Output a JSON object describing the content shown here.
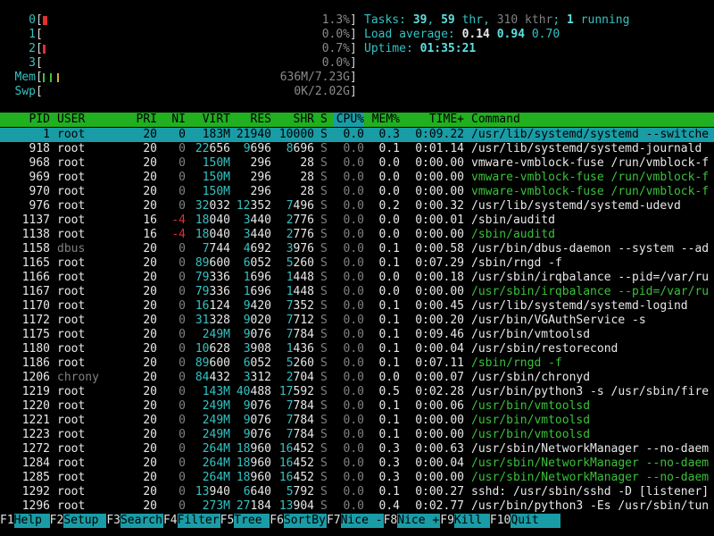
{
  "meters": {
    "cpu": [
      {
        "label": "0",
        "value": "1.3%",
        "fill": 0.02
      },
      {
        "label": "1",
        "value": "0.0%",
        "fill": 0.0
      },
      {
        "label": "2",
        "value": "0.7%",
        "fill": 0.01
      },
      {
        "label": "3",
        "value": "0.0%",
        "fill": 0.0
      }
    ],
    "mem": {
      "label": "Mem",
      "value": "636M/7.23G",
      "fill": 0.086
    },
    "swp": {
      "label": "Swp",
      "value": "0K/2.02G",
      "fill": 0.0
    }
  },
  "summary": {
    "tasks_label": "Tasks: ",
    "tasks": "39",
    "sep1": ", ",
    "thr": "59",
    "thr_label": " thr, ",
    "kthr": "310 kthr",
    "sep2": "; ",
    "running": "1",
    "running_label": " running",
    "load_label": "Load average: ",
    "load1": "0.14",
    "load5": "0.94",
    "load15": "0.70",
    "uptime_label": "Uptime: ",
    "uptime": "01:35:21"
  },
  "columns": {
    "pid": "PID",
    "user": "USER",
    "pri": "PRI",
    "ni": "NI",
    "virt": "VIRT",
    "res": "RES",
    "shr": "SHR",
    "s": "S",
    "cpu": "CPU%",
    "mem": "MEM%",
    "time": "TIME+",
    "command": "Command"
  },
  "processes": [
    {
      "pid": "1",
      "user": "root",
      "pri": "20",
      "ni": "0",
      "virt": "183M",
      "res": "21940",
      "shr": "10000",
      "s": "S",
      "cpu": "0.0",
      "mem": "0.3",
      "time": "0:09.22",
      "command": "/usr/lib/systemd/systemd --switche",
      "selected": true
    },
    {
      "pid": "918",
      "user": "root",
      "pri": "20",
      "ni": "0",
      "virt": "22656",
      "res": "9696",
      "shr": "8696",
      "s": "S",
      "cpu": "0.0",
      "mem": "0.1",
      "time": "0:01.14",
      "command": "/usr/lib/systemd/systemd-journald"
    },
    {
      "pid": "968",
      "user": "root",
      "pri": "20",
      "ni": "0",
      "virt": "150M",
      "res": "296",
      "shr": "28",
      "s": "S",
      "cpu": "0.0",
      "mem": "0.0",
      "time": "0:00.00",
      "command": "vmware-vmblock-fuse /run/vmblock-f"
    },
    {
      "pid": "969",
      "user": "root",
      "pri": "20",
      "ni": "0",
      "virt": "150M",
      "res": "296",
      "shr": "28",
      "s": "S",
      "cpu": "0.0",
      "mem": "0.0",
      "time": "0:00.00",
      "command": "vmware-vmblock-fuse /run/vmblock-f",
      "thread": true
    },
    {
      "pid": "970",
      "user": "root",
      "pri": "20",
      "ni": "0",
      "virt": "150M",
      "res": "296",
      "shr": "28",
      "s": "S",
      "cpu": "0.0",
      "mem": "0.0",
      "time": "0:00.00",
      "command": "vmware-vmblock-fuse /run/vmblock-f",
      "thread": true
    },
    {
      "pid": "976",
      "user": "root",
      "pri": "20",
      "ni": "0",
      "virt": "32032",
      "res": "12352",
      "shr": "7496",
      "s": "S",
      "cpu": "0.0",
      "mem": "0.2",
      "time": "0:00.32",
      "command": "/usr/lib/systemd/systemd-udevd"
    },
    {
      "pid": "1137",
      "user": "root",
      "pri": "16",
      "ni": "-4",
      "virt": "18040",
      "res": "3440",
      "shr": "2776",
      "s": "S",
      "cpu": "0.0",
      "mem": "0.0",
      "time": "0:00.01",
      "command": "/sbin/auditd"
    },
    {
      "pid": "1138",
      "user": "root",
      "pri": "16",
      "ni": "-4",
      "virt": "18040",
      "res": "3440",
      "shr": "2776",
      "s": "S",
      "cpu": "0.0",
      "mem": "0.0",
      "time": "0:00.00",
      "command": "/sbin/auditd",
      "thread": true
    },
    {
      "pid": "1158",
      "user": "dbus",
      "pri": "20",
      "ni": "0",
      "virt": "7744",
      "res": "4692",
      "shr": "3976",
      "s": "S",
      "cpu": "0.0",
      "mem": "0.1",
      "time": "0:00.58",
      "command": "/usr/bin/dbus-daemon --system --ad",
      "grayuser": true
    },
    {
      "pid": "1165",
      "user": "root",
      "pri": "20",
      "ni": "0",
      "virt": "89600",
      "res": "6052",
      "shr": "5260",
      "s": "S",
      "cpu": "0.0",
      "mem": "0.1",
      "time": "0:07.29",
      "command": "/sbin/rngd -f"
    },
    {
      "pid": "1166",
      "user": "root",
      "pri": "20",
      "ni": "0",
      "virt": "79336",
      "res": "1696",
      "shr": "1448",
      "s": "S",
      "cpu": "0.0",
      "mem": "0.0",
      "time": "0:00.18",
      "command": "/usr/sbin/irqbalance --pid=/var/ru"
    },
    {
      "pid": "1167",
      "user": "root",
      "pri": "20",
      "ni": "0",
      "virt": "79336",
      "res": "1696",
      "shr": "1448",
      "s": "S",
      "cpu": "0.0",
      "mem": "0.0",
      "time": "0:00.00",
      "command": "/usr/sbin/irqbalance --pid=/var/ru",
      "thread": true
    },
    {
      "pid": "1170",
      "user": "root",
      "pri": "20",
      "ni": "0",
      "virt": "16124",
      "res": "9420",
      "shr": "7352",
      "s": "S",
      "cpu": "0.0",
      "mem": "0.1",
      "time": "0:00.45",
      "command": "/usr/lib/systemd/systemd-logind"
    },
    {
      "pid": "1172",
      "user": "root",
      "pri": "20",
      "ni": "0",
      "virt": "31328",
      "res": "9020",
      "shr": "7712",
      "s": "S",
      "cpu": "0.0",
      "mem": "0.1",
      "time": "0:00.20",
      "command": "/usr/bin/VGAuthService -s"
    },
    {
      "pid": "1175",
      "user": "root",
      "pri": "20",
      "ni": "0",
      "virt": "249M",
      "res": "9076",
      "shr": "7784",
      "s": "S",
      "cpu": "0.0",
      "mem": "0.1",
      "time": "0:09.46",
      "command": "/usr/bin/vmtoolsd"
    },
    {
      "pid": "1180",
      "user": "root",
      "pri": "20",
      "ni": "0",
      "virt": "10628",
      "res": "3908",
      "shr": "1436",
      "s": "S",
      "cpu": "0.0",
      "mem": "0.1",
      "time": "0:00.04",
      "command": "/usr/sbin/restorecond"
    },
    {
      "pid": "1186",
      "user": "root",
      "pri": "20",
      "ni": "0",
      "virt": "89600",
      "res": "6052",
      "shr": "5260",
      "s": "S",
      "cpu": "0.0",
      "mem": "0.1",
      "time": "0:07.11",
      "command": "/sbin/rngd -f",
      "thread": true
    },
    {
      "pid": "1206",
      "user": "chrony",
      "pri": "20",
      "ni": "0",
      "virt": "84432",
      "res": "3312",
      "shr": "2704",
      "s": "S",
      "cpu": "0.0",
      "mem": "0.0",
      "time": "0:00.07",
      "command": "/usr/sbin/chronyd",
      "grayuser": true
    },
    {
      "pid": "1219",
      "user": "root",
      "pri": "20",
      "ni": "0",
      "virt": "143M",
      "res": "40488",
      "shr": "17592",
      "s": "S",
      "cpu": "0.0",
      "mem": "0.5",
      "time": "0:02.28",
      "command": "/usr/bin/python3 -s /usr/sbin/fire"
    },
    {
      "pid": "1220",
      "user": "root",
      "pri": "20",
      "ni": "0",
      "virt": "249M",
      "res": "9076",
      "shr": "7784",
      "s": "S",
      "cpu": "0.0",
      "mem": "0.1",
      "time": "0:00.06",
      "command": "/usr/bin/vmtoolsd",
      "thread": true
    },
    {
      "pid": "1221",
      "user": "root",
      "pri": "20",
      "ni": "0",
      "virt": "249M",
      "res": "9076",
      "shr": "7784",
      "s": "S",
      "cpu": "0.0",
      "mem": "0.1",
      "time": "0:00.00",
      "command": "/usr/bin/vmtoolsd",
      "thread": true
    },
    {
      "pid": "1223",
      "user": "root",
      "pri": "20",
      "ni": "0",
      "virt": "249M",
      "res": "9076",
      "shr": "7784",
      "s": "S",
      "cpu": "0.0",
      "mem": "0.1",
      "time": "0:00.00",
      "command": "/usr/bin/vmtoolsd",
      "thread": true
    },
    {
      "pid": "1272",
      "user": "root",
      "pri": "20",
      "ni": "0",
      "virt": "264M",
      "res": "18960",
      "shr": "16452",
      "s": "S",
      "cpu": "0.0",
      "mem": "0.3",
      "time": "0:00.63",
      "command": "/usr/sbin/NetworkManager --no-daem"
    },
    {
      "pid": "1284",
      "user": "root",
      "pri": "20",
      "ni": "0",
      "virt": "264M",
      "res": "18960",
      "shr": "16452",
      "s": "S",
      "cpu": "0.0",
      "mem": "0.3",
      "time": "0:00.04",
      "command": "/usr/sbin/NetworkManager --no-daem",
      "thread": true
    },
    {
      "pid": "1285",
      "user": "root",
      "pri": "20",
      "ni": "0",
      "virt": "264M",
      "res": "18960",
      "shr": "16452",
      "s": "S",
      "cpu": "0.0",
      "mem": "0.3",
      "time": "0:00.00",
      "command": "/usr/sbin/NetworkManager --no-daem",
      "thread": true
    },
    {
      "pid": "1292",
      "user": "root",
      "pri": "20",
      "ni": "0",
      "virt": "13940",
      "res": "6640",
      "shr": "5792",
      "s": "S",
      "cpu": "0.0",
      "mem": "0.1",
      "time": "0:00.27",
      "command": "sshd: /usr/sbin/sshd -D [listener]"
    },
    {
      "pid": "1296",
      "user": "root",
      "pri": "20",
      "ni": "0",
      "virt": "273M",
      "res": "27184",
      "shr": "13904",
      "s": "S",
      "cpu": "0.0",
      "mem": "0.4",
      "time": "0:02.77",
      "command": "/usr/bin/python3 -Es /usr/sbin/tun"
    }
  ],
  "fkeys": [
    {
      "key": "F1",
      "label": "Help"
    },
    {
      "key": "F2",
      "label": "Setup"
    },
    {
      "key": "F3",
      "label": "Search"
    },
    {
      "key": "F4",
      "label": "Filter"
    },
    {
      "key": "F5",
      "label": "Tree"
    },
    {
      "key": "F6",
      "label": "SortBy"
    },
    {
      "key": "F7",
      "label": "Nice -"
    },
    {
      "key": "F8",
      "label": "Nice +"
    },
    {
      "key": "F9",
      "label": "Kill"
    },
    {
      "key": "F10",
      "label": "Quit"
    }
  ],
  "colors": {
    "header_bg": "#20b020",
    "selected_bg": "#1a9ca6",
    "cyan": "#33c3c3",
    "green": "#39c239",
    "red": "#e03030"
  }
}
